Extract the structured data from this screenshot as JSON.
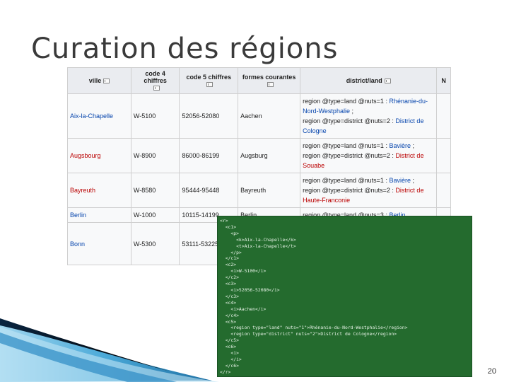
{
  "slide": {
    "title": "Curation des régions",
    "page_number": "20"
  },
  "table": {
    "headers": [
      "ville",
      "code 4 chiffres",
      "code 5 chiffres",
      "formes courantes",
      "district/land",
      "N"
    ],
    "rows": [
      {
        "ville": "Aix-la-Chapelle",
        "ville_link": "blue",
        "code4": "W-5100",
        "code5": "52056-52080",
        "formes": "Aachen",
        "d1_pre": "region @type=land @nuts=1 : ",
        "d1_link": "Rhénanie-du-Nord-Westphalie",
        "d1_post": " ;",
        "d2_pre": "region @type=district @nuts=2 : ",
        "d2_link": "District de Cologne",
        "d2_post": "",
        "d2_color": "blue"
      },
      {
        "ville": "Augsbourg",
        "ville_link": "red",
        "code4": "W-8900",
        "code5": "86000-86199",
        "formes": "Augsburg",
        "d1_pre": "region @type=land @nuts=1 : ",
        "d1_link": "Bavière",
        "d1_post": " ;",
        "d2_pre": "region @type=district @nuts=2 : ",
        "d2_link": "District de Souabe",
        "d2_post": "",
        "d2_color": "red"
      },
      {
        "ville": "Bayreuth",
        "ville_link": "red",
        "code4": "W-8580",
        "code5": "95444-95448",
        "formes": "Bayreuth",
        "d1_pre": "region @type=land @nuts=1 : ",
        "d1_link": "Bavière",
        "d1_post": " ;",
        "d2_pre": "region @type=district @nuts=2 : ",
        "d2_link": "District de Haute-Franconie",
        "d2_post": "",
        "d2_color": "red"
      },
      {
        "ville": "Berlin",
        "ville_link": "blue",
        "code4": "W-1000",
        "code5": "10115-14199",
        "formes": "Berlin",
        "d1_pre": "region @type=land @nuts=3 : ",
        "d1_link": "Berlin",
        "d1_post": ""
      },
      {
        "ville": "Bonn",
        "ville_link": "blue",
        "code4": "W-5300",
        "code5": "53111-53225",
        "formes": "",
        "d1_pre": "",
        "d1_link": "",
        "d1_post": ""
      }
    ]
  },
  "code_block": {
    "lines": [
      "<r>",
      "  <c1>",
      "    <p>",
      "      <k>Aix-la-Chapelle</k>",
      "      <t>Aix-la-Chapelle</t>",
      "    </p>",
      "  </c1>",
      "  <c2>",
      "    <i>W-5100</i>",
      "  </c2>",
      "  <c3>",
      "    <i>52056-52080</i>",
      "  </c3>",
      "  <c4>",
      "    <i>Aachen</i>",
      "  </c4>",
      "  <c5>",
      "    <region type=\"land\" nuts=\"1\">Rhénanie-du-Nord-Westphalie</region>",
      "    <region type=\"district\" nuts=\"2\">District de Cologne</region>",
      "  </c5>",
      "  <c6>",
      "    <i>",
      "    </i>",
      "  </c6>",
      "</r>"
    ]
  },
  "colors": {
    "link_blue": "#0645ad",
    "link_red": "#ba0000",
    "code_bg": "#246b2e",
    "swoosh_dark": "#0b2a4a",
    "swoosh_light": "#5ab3e0"
  }
}
